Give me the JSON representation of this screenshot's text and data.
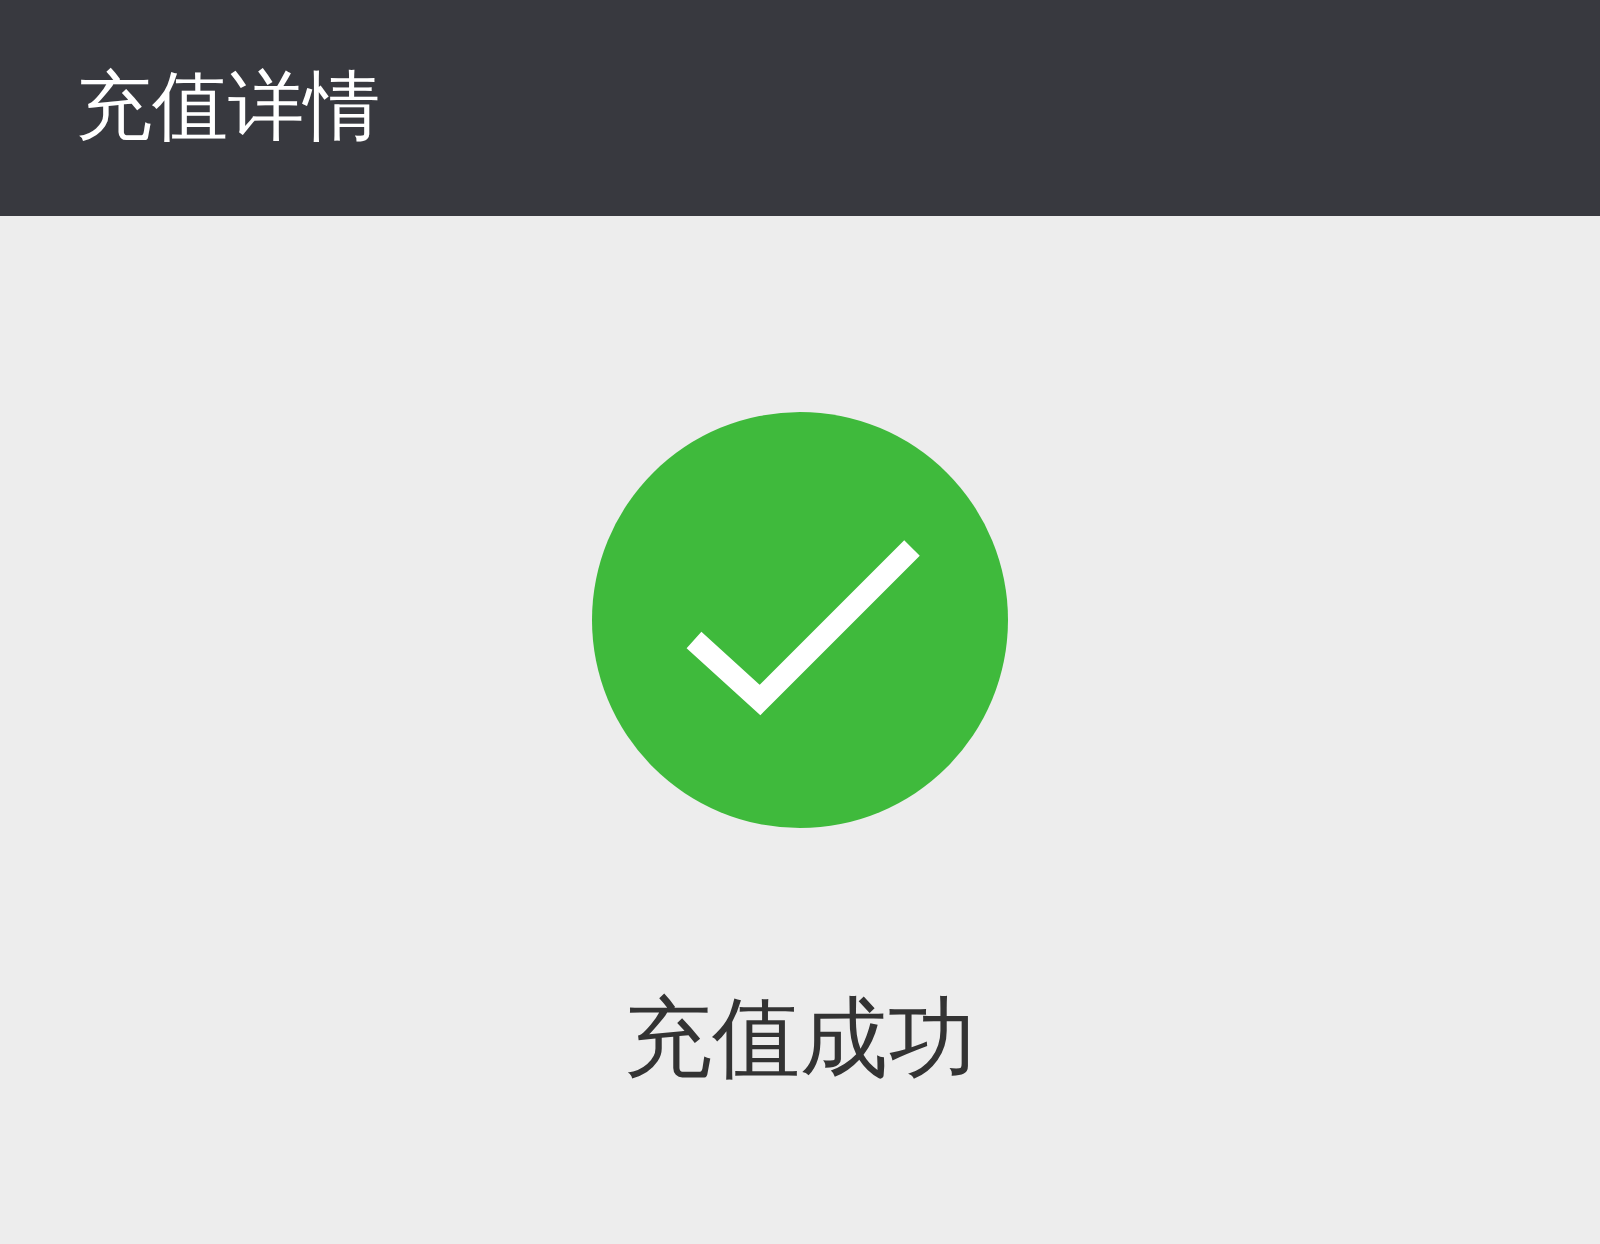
{
  "header": {
    "title": "充值详情"
  },
  "result": {
    "success": true,
    "message": "充值成功"
  }
}
